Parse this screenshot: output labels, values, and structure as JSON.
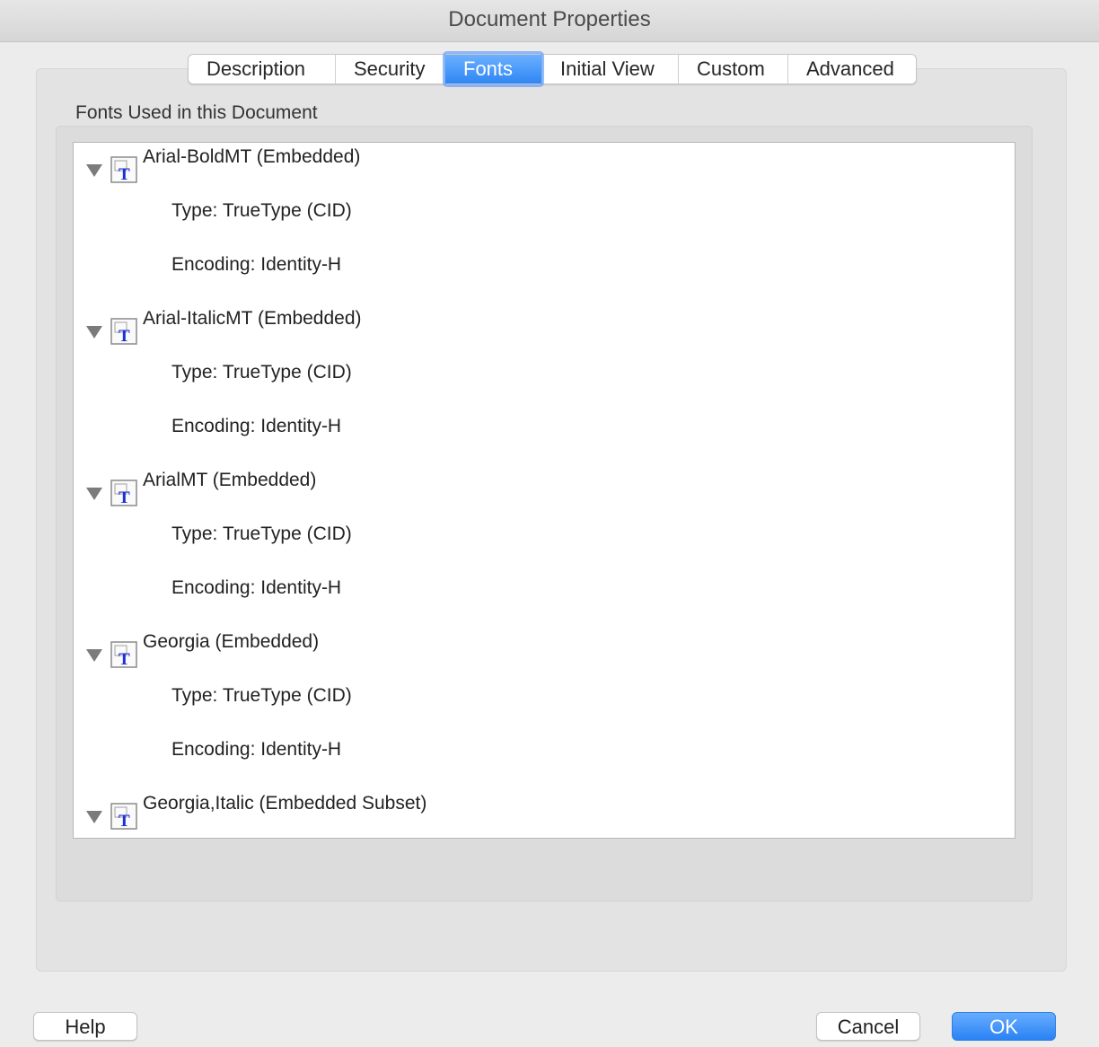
{
  "window": {
    "title": "Document Properties"
  },
  "tabs": [
    {
      "label": "Description",
      "active": false
    },
    {
      "label": "Security",
      "active": false
    },
    {
      "label": "Fonts",
      "active": true
    },
    {
      "label": "Initial View",
      "active": false
    },
    {
      "label": "Custom",
      "active": false
    },
    {
      "label": "Advanced",
      "active": false
    }
  ],
  "fonts_panel": {
    "group_label": "Fonts Used in this Document",
    "fonts": [
      {
        "name": "Arial-BoldMT (Embedded)",
        "type": "Type: TrueType (CID)",
        "encoding": "Encoding: Identity-H",
        "expanded": true
      },
      {
        "name": "Arial-ItalicMT (Embedded)",
        "type": "Type: TrueType (CID)",
        "encoding": "Encoding: Identity-H",
        "expanded": true
      },
      {
        "name": "ArialMT (Embedded)",
        "type": "Type: TrueType (CID)",
        "encoding": "Encoding: Identity-H",
        "expanded": true
      },
      {
        "name": "Georgia (Embedded)",
        "type": "Type: TrueType (CID)",
        "encoding": "Encoding: Identity-H",
        "expanded": true
      },
      {
        "name": "Georgia,Italic (Embedded Subset)",
        "expanded": true
      }
    ],
    "icon": "truetype-font-icon"
  },
  "buttons": {
    "help": "Help",
    "cancel": "Cancel",
    "ok": "OK"
  },
  "colors": {
    "accent": "#2f86f5",
    "font_icon_glyph": "#1a2fd6"
  }
}
